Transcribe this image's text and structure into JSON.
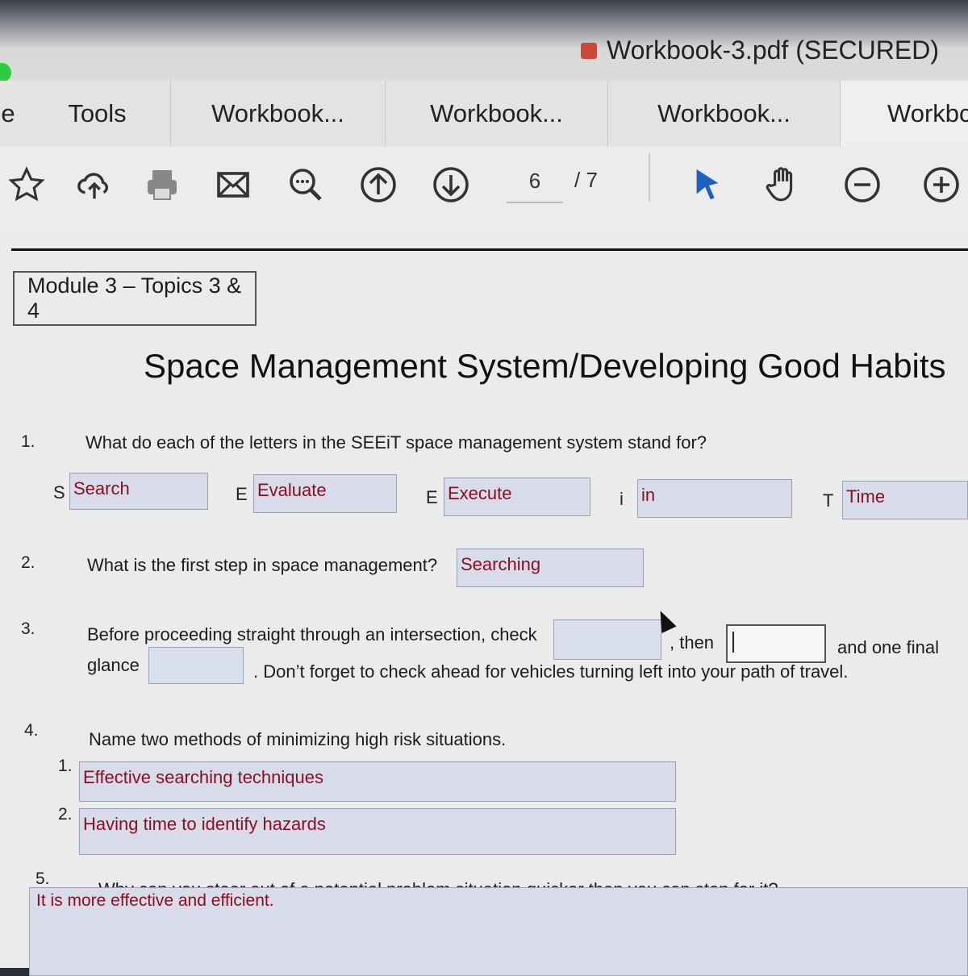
{
  "window": {
    "title": "Workbook-3.pdf (SECURED)"
  },
  "tabs": [
    {
      "label": "e"
    },
    {
      "label": "Tools"
    },
    {
      "label": "Workbook..."
    },
    {
      "label": "Workbook..."
    },
    {
      "label": "Workbook..."
    },
    {
      "label": "Workbc"
    }
  ],
  "toolbar": {
    "icons": [
      "star-icon",
      "cloud-upload-icon",
      "print-icon",
      "mail-icon",
      "search-zoom-icon",
      "page-up-icon",
      "page-down-icon",
      "select-arrow-icon",
      "hand-tool-icon",
      "zoom-out-icon",
      "zoom-in-icon"
    ],
    "page_current": "6",
    "page_total": "/ 7"
  },
  "document": {
    "module_label": "Module 3 – Topics 3 & 4",
    "heading": "Space Management System/Developing Good Habits",
    "q1": {
      "num": "1.",
      "text": "What do each of the letters in the SEEiT space management system stand for?",
      "letters": [
        {
          "letter": "S",
          "answer": "Search"
        },
        {
          "letter": "E",
          "answer": "Evaluate"
        },
        {
          "letter": "E",
          "answer": "Execute"
        },
        {
          "letter": "i",
          "answer": "in"
        },
        {
          "letter": "T",
          "answer": "Time"
        }
      ]
    },
    "q2": {
      "num": "2.",
      "text": "What is the first step in space management?",
      "answer": "Searching"
    },
    "q3": {
      "num": "3.",
      "text_a": "Before proceeding straight through an intersection, check",
      "text_b": ", then",
      "text_c": "and one final",
      "text_d": "glance",
      "text_e": ". Don’t forget to check ahead for vehicles turning left into your path of travel."
    },
    "q4": {
      "num": "4.",
      "text": "Name two methods of minimizing high risk situations.",
      "items": [
        {
          "num": "1.",
          "answer": "Effective searching techniques"
        },
        {
          "num": "2.",
          "answer": "Having time to identify hazards"
        }
      ]
    },
    "q5": {
      "num": "5.",
      "text": "Why can you steer out of a potential problem situation quicker than you can stop for it?",
      "answer": "It is more effective and efficient."
    }
  }
}
